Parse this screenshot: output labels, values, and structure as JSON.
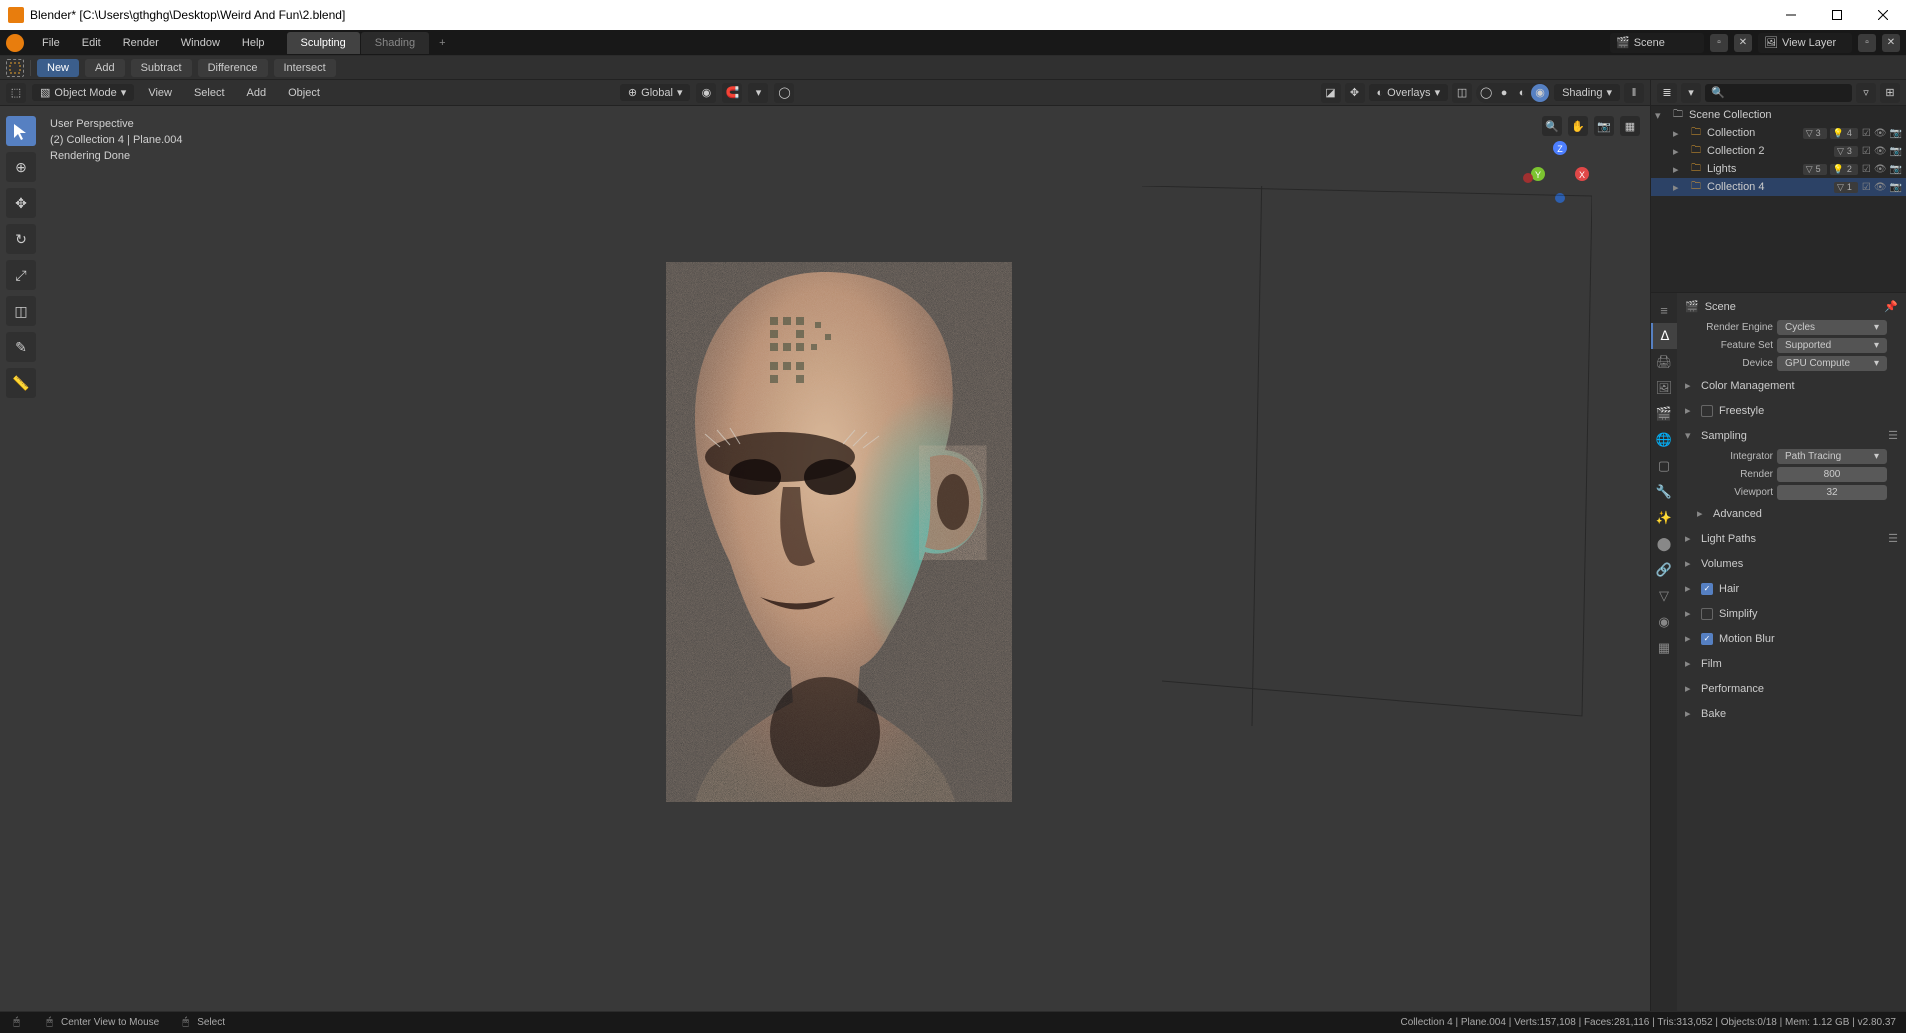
{
  "window": {
    "title": "Blender* [C:\\Users\\gthghg\\Desktop\\Weird And Fun\\2.blend]"
  },
  "menus": [
    "File",
    "Edit",
    "Render",
    "Window",
    "Help"
  ],
  "workspaces": {
    "tabs": [
      "Sculpting",
      "Shading"
    ],
    "active": "Sculpting"
  },
  "topbar_right": {
    "scene_label": "Scene",
    "view_layer_label": "View Layer"
  },
  "toolbar2": {
    "new": "New",
    "add": "Add",
    "subtract": "Subtract",
    "difference": "Difference",
    "intersect": "Intersect"
  },
  "viewport_header": {
    "mode": "Object Mode",
    "menus": [
      "View",
      "Select",
      "Add",
      "Object"
    ],
    "orientation": "Global",
    "overlays_label": "Overlays",
    "shading_label": "Shading"
  },
  "viewport_info": {
    "line1": "User Perspective",
    "line2": "(2) Collection 4 | Plane.004",
    "line3": "Rendering Done"
  },
  "outliner": {
    "root": "Scene Collection",
    "items": [
      {
        "label": "Collection",
        "badge1": "3",
        "badge2": "4"
      },
      {
        "label": "Collection 2",
        "badge1": "3"
      },
      {
        "label": "Lights",
        "badge1": "5",
        "badge2": "2"
      },
      {
        "label": "Collection 4",
        "badge1": "1",
        "selected": true
      }
    ]
  },
  "properties": {
    "context_label": "Scene",
    "render_engine": {
      "label": "Render Engine",
      "value": "Cycles"
    },
    "feature_set": {
      "label": "Feature Set",
      "value": "Supported"
    },
    "device": {
      "label": "Device",
      "value": "GPU Compute"
    },
    "panels": {
      "color_management": "Color Management",
      "freestyle": "Freestyle",
      "sampling": "Sampling",
      "integrator": {
        "label": "Integrator",
        "value": "Path Tracing"
      },
      "render_samples": {
        "label": "Render",
        "value": "800"
      },
      "viewport_samples": {
        "label": "Viewport",
        "value": "32"
      },
      "advanced": "Advanced",
      "light_paths": "Light Paths",
      "volumes": "Volumes",
      "hair": "Hair",
      "simplify": "Simplify",
      "motion_blur": "Motion Blur",
      "film": "Film",
      "performance": "Performance",
      "bake": "Bake"
    }
  },
  "statusbar": {
    "hint1": "Center View to Mouse",
    "hint2": "Select",
    "stats": "Collection 4 | Plane.004 | Verts:157,108 | Faces:281,116 | Tris:313,052 | Objects:0/18 | Mem: 1.12 GB | v2.80.37"
  }
}
